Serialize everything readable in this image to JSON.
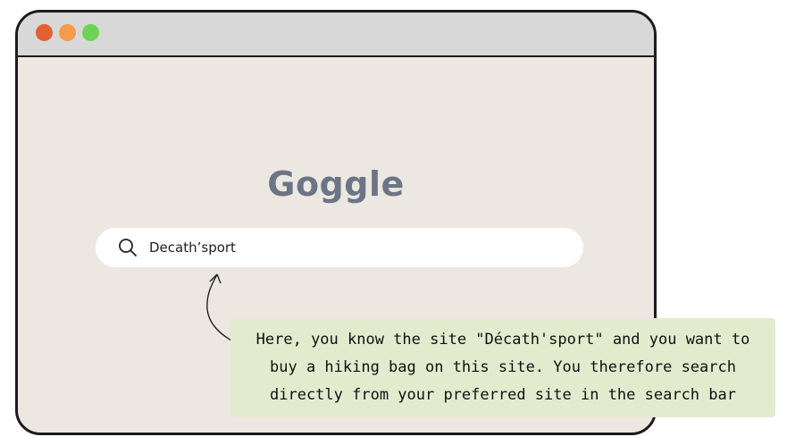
{
  "window": {
    "controls": [
      {
        "name": "close-icon",
        "color": "#e36031"
      },
      {
        "name": "minimize-icon",
        "color": "#f79a4a"
      },
      {
        "name": "zoom-icon",
        "color": "#6bd356"
      }
    ]
  },
  "logo": {
    "text": "Goggle",
    "color": "#6c7585"
  },
  "search": {
    "icon": "search-icon",
    "value": "Decath’sport"
  },
  "annotation": {
    "lines": [
      "Here, you know the site \"Décath'sport\" and you want to",
      "buy a hiking bag on this site. You therefore search",
      "directly from your preferred site in the search bar"
    ],
    "background": "#e3ebcf"
  }
}
